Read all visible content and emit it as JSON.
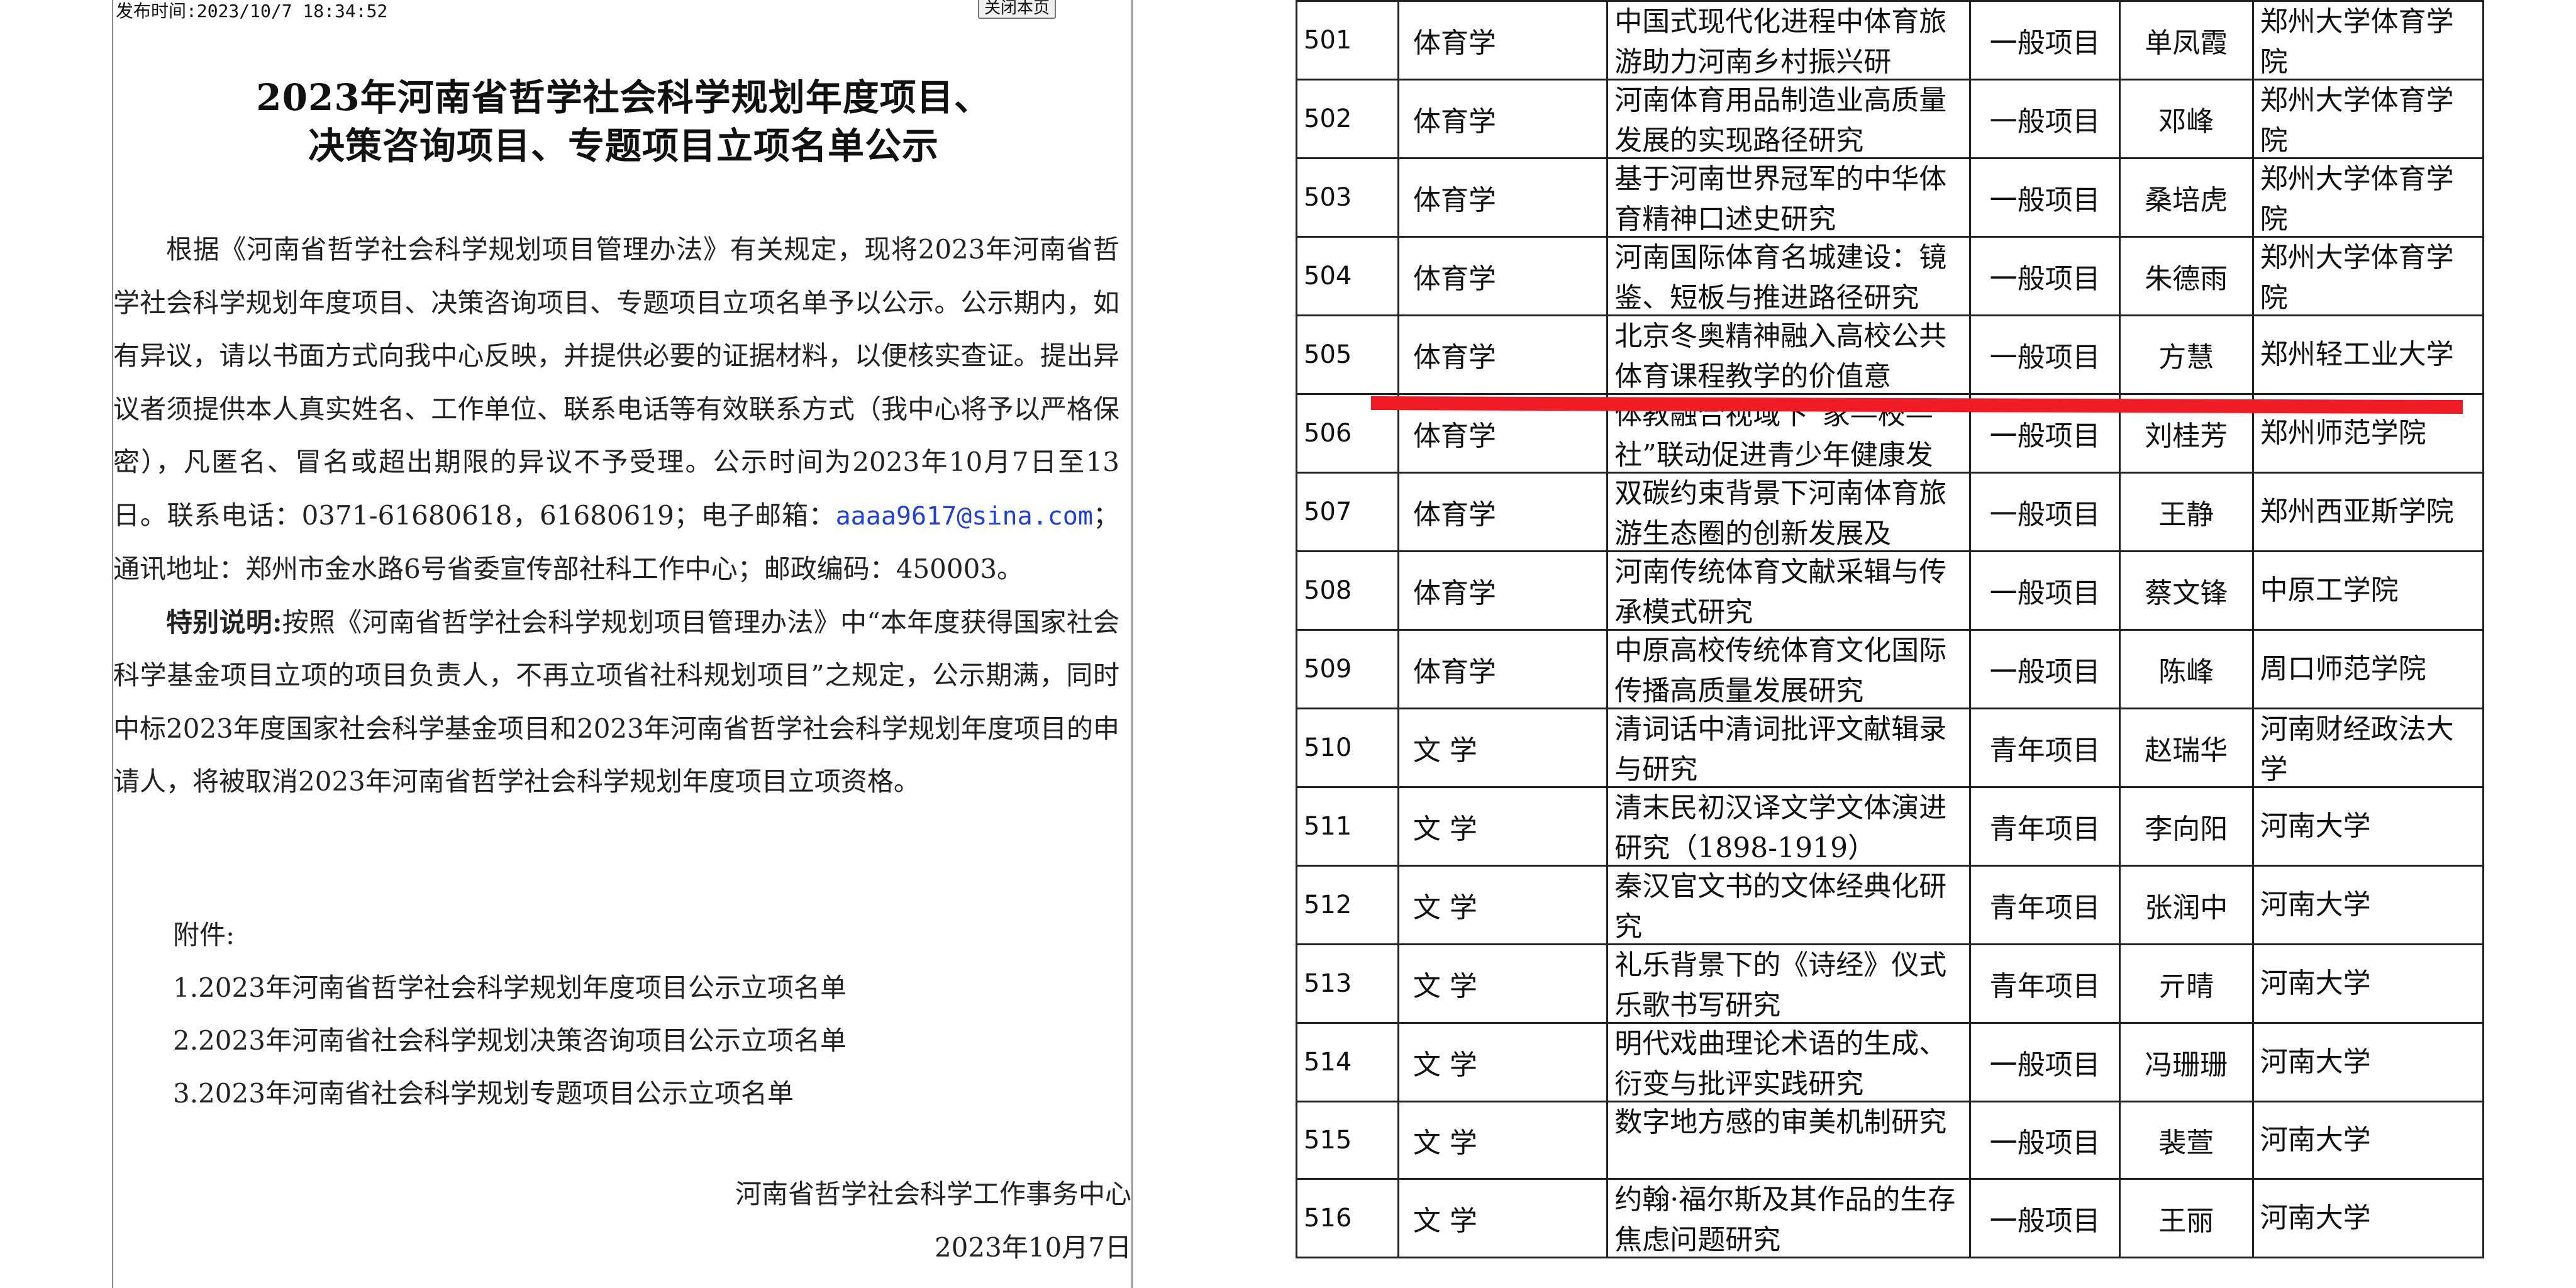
{
  "announcement": {
    "publish_time": "发布时间:2023/10/7 18:34:52",
    "close_button": "关闭本页",
    "title_line1": "2023年河南省哲学社会科学规划年度项目、",
    "title_line2": "决策咨询项目、专题项目立项名单公示",
    "para1_before_email": "根据《河南省哲学社会科学规划项目管理办法》有关规定，现将2023年河南省哲学社会科学规划年度项目、决策咨询项目、专题项目立项名单予以公示。公示期内，如有异议，请以书面方式向我中心反映，并提供必要的证据材料，以便核实查证。提出异议者须提供本人真实姓名、工作单位、联系电话等有效联系方式（我中心将予以严格保密），凡匿名、冒名或超出期限的异议不予受理。公示时间为2023年10月7日至13日。联系电话：0371-61680618，61680619；电子邮箱：",
    "email": "aaaa9617@sina.com",
    "para1_after_email": "；通讯地址：郑州市金水路6号省委宣传部社科工作中心；邮政编码：450003。",
    "special_label": "特别说明:",
    "special_text": "按照《河南省哲学社会科学规划项目管理办法》中“本年度获得国家社会科学基金项目立项的项目负责人，不再立项省社科规划项目”之规定，公示期满，同时中标2023年度国家社会科学基金项目和2023年河南省哲学社会科学规划年度项目的申请人，将被取消2023年河南省哲学社会科学规划年度项目立项资格。",
    "attachments_heading": "附件:",
    "attachments": [
      "1.2023年河南省哲学社会科学规划年度项目公示立项名单",
      "2.2023年河南省社会科学规划决策咨询项目公示立项名单",
      "3.2023年河南省社会科学规划专题项目公示立项名单"
    ],
    "signature_org": "河南省哲学社会科学工作事务中心",
    "signature_date": "2023年10月7日"
  },
  "project_table": {
    "rows": [
      {
        "no": "501",
        "subject": "体育学",
        "name": "中国式现代化进程中体育旅游助力河南乡村振兴研",
        "type": "一般项目",
        "leader": "单凤霞",
        "unit": "郑州大学体育学院"
      },
      {
        "no": "502",
        "subject": "体育学",
        "name": "河南体育用品制造业高质量发展的实现路径研究",
        "type": "一般项目",
        "leader": "邓峰",
        "unit": "郑州大学体育学院"
      },
      {
        "no": "503",
        "subject": "体育学",
        "name": "基于河南世界冠军的中华体育精神口述史研究",
        "type": "一般项目",
        "leader": "桑培虎",
        "unit": "郑州大学体育学院"
      },
      {
        "no": "504",
        "subject": "体育学",
        "name": "河南国际体育名城建设：镜鉴、短板与推进路径研究",
        "type": "一般项目",
        "leader": "朱德雨",
        "unit": "郑州大学体育学院"
      },
      {
        "no": "505",
        "subject": "体育学",
        "name": "北京冬奥精神融入高校公共体育课程教学的价值意",
        "type": "一般项目",
        "leader": "方慧",
        "unit": "郑州轻工业大学"
      },
      {
        "no": "506",
        "subject": "体育学",
        "name": "体教融合视域下“家—校—社”联动促进青少年健康发",
        "type": "一般项目",
        "leader": "刘桂芳",
        "unit": "郑州师范学院"
      },
      {
        "no": "507",
        "subject": "体育学",
        "name": "双碳约束背景下河南体育旅游生态圈的创新发展及",
        "type": "一般项目",
        "leader": "王静",
        "unit": "郑州西亚斯学院"
      },
      {
        "no": "508",
        "subject": "体育学",
        "name": "河南传统体育文献采辑与传承模式研究",
        "type": "一般项目",
        "leader": "蔡文锋",
        "unit": "中原工学院"
      },
      {
        "no": "509",
        "subject": "体育学",
        "name": "中原高校传统体育文化国际传播高质量发展研究",
        "type": "一般项目",
        "leader": "陈峰",
        "unit": "周口师范学院"
      },
      {
        "no": "510",
        "subject": "文 学",
        "name": "清词话中清词批评文献辑录与研究",
        "type": "青年项目",
        "leader": "赵瑞华",
        "unit": "河南财经政法大学"
      },
      {
        "no": "511",
        "subject": "文 学",
        "name": "清末民初汉译文学文体演进研究（1898-1919）",
        "type": "青年项目",
        "leader": "李向阳",
        "unit": "河南大学"
      },
      {
        "no": "512",
        "subject": "文 学",
        "name": "秦汉官文书的文体经典化研究",
        "type": "青年项目",
        "leader": "张润中",
        "unit": "河南大学"
      },
      {
        "no": "513",
        "subject": "文 学",
        "name": "礼乐背景下的《诗经》仪式乐歌书写研究",
        "type": "青年项目",
        "leader": "亓晴",
        "unit": "河南大学"
      },
      {
        "no": "514",
        "subject": "文 学",
        "name": "明代戏曲理论术语的生成、衍变与批评实践研究",
        "type": "一般项目",
        "leader": "冯珊珊",
        "unit": "河南大学"
      },
      {
        "no": "515",
        "subject": "文 学",
        "name": "数字地方感的审美机制研究",
        "type": "一般项目",
        "leader": "裴萱",
        "unit": "河南大学"
      },
      {
        "no": "516",
        "subject": "文 学",
        "name": "约翰·福尔斯及其作品的生存焦虑问题研究",
        "type": "一般项目",
        "leader": "王丽",
        "unit": "河南大学"
      }
    ]
  },
  "colors": {
    "highlight_line": "#ef1c25",
    "email_link": "#1f3fd6"
  }
}
